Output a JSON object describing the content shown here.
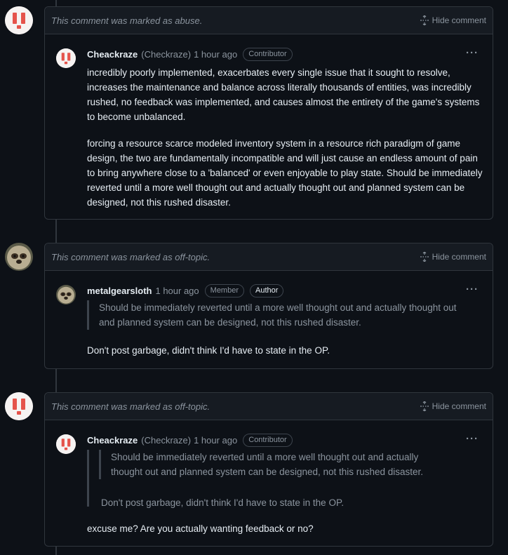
{
  "comments": [
    {
      "marked_text": "This comment was marked as abuse.",
      "hide_label": "Hide comment",
      "author": "Cheackraze",
      "alias": "(Checkraze)",
      "time": "1 hour ago",
      "badges": [
        "Contributor"
      ],
      "paragraphs": [
        "incredibly poorly implemented, exacerbates every single issue that it sought to resolve, increases the maintenance and balance across literally thousands of entities, was incredibly rushed, no feedback was implemented, and causes almost the entirety of the game's systems to become unbalanced.",
        "forcing a resource scarce modeled inventory system in a resource rich paradigm of game design, the two are fundamentally incompatible and will just cause an endless amount of pain to bring anywhere close to a 'balanced' or even enjoyable to play state. Should be immediately reverted until a more well thought out and actually thought out and planned system can be designed, not this rushed disaster."
      ]
    },
    {
      "marked_text": "This comment was marked as off-topic.",
      "hide_label": "Hide comment",
      "author": "metalgearsloth",
      "alias": "",
      "time": "1 hour ago",
      "badges": [
        "Member",
        "Author"
      ],
      "quote": "Should be immediately reverted until a more well thought out and actually thought out and planned system can be designed, not this rushed disaster.",
      "paragraphs": [
        "Don't post garbage, didn't think I'd have to state in the OP."
      ]
    },
    {
      "marked_text": "This comment was marked as off-topic.",
      "hide_label": "Hide comment",
      "author": "Cheackraze",
      "alias": "(Checkraze)",
      "time": "1 hour ago",
      "badges": [
        "Contributor"
      ],
      "nested_quote": "Should be immediately reverted until a more well thought out and actually thought out and planned system can be designed, not this rushed disaster.",
      "quote": "Don't post garbage, didn't think I'd have to state in the OP.",
      "paragraphs": [
        "excuse me? Are you actually wanting feedback or no?"
      ]
    }
  ],
  "colors": {
    "background": "#0d1117",
    "border": "#30363d",
    "muted": "#8b949e",
    "text": "#e6edf3",
    "alert_red": "#e5534b"
  },
  "icons": {
    "hide": "unfold-icon",
    "menu": "kebab-icon",
    "avatar_alert": "alert-avatar",
    "avatar_sloth": "sloth-avatar"
  }
}
